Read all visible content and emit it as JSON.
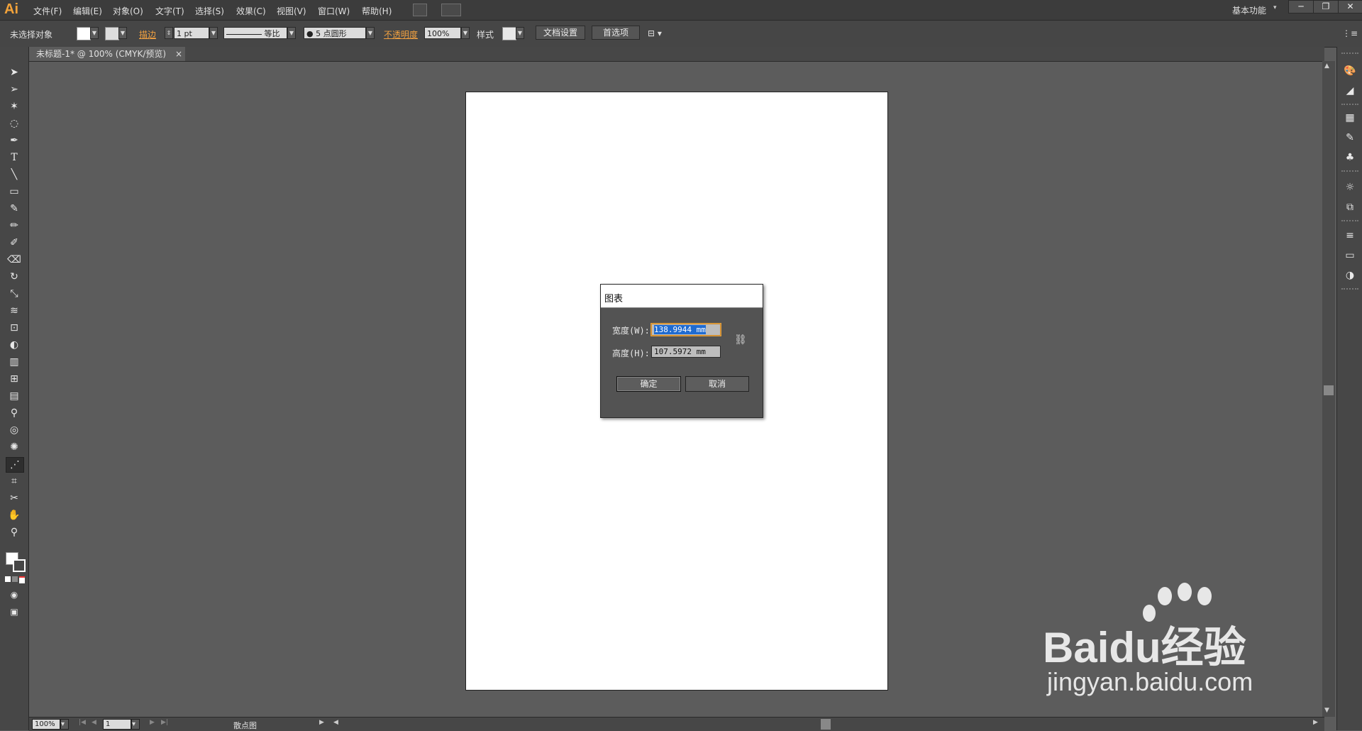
{
  "app": {
    "logo": "Ai"
  },
  "menu": [
    "文件(F)",
    "编辑(E)",
    "对象(O)",
    "文字(T)",
    "选择(S)",
    "效果(C)",
    "视图(V)",
    "窗口(W)",
    "帮助(H)"
  ],
  "workspace": {
    "label": "基本功能"
  },
  "window_controls": {
    "minimize": "─",
    "restore": "❐",
    "close": "✕"
  },
  "controlbar": {
    "selection_status": "未选择对象",
    "stroke_label": "描边",
    "stroke_weight": "1 pt",
    "stroke_profile": "等比",
    "brush": "● 5 点圆形",
    "opacity_label": "不透明度",
    "opacity_value": "100%",
    "style_label": "样式",
    "doc_setup_button": "文档设置",
    "preferences_button": "首选项"
  },
  "document_tab": {
    "title": "未标题-1* @ 100% (CMYK/预览)",
    "close": "×"
  },
  "dialog": {
    "title": "图表",
    "width_label": "宽度(W):",
    "width_value": "138.9944 mm",
    "height_label": "高度(H):",
    "height_value": "107.5972 mm",
    "ok_button": "确定",
    "cancel_button": "取消"
  },
  "statusbar": {
    "zoom": "100%",
    "page": "1",
    "tool_name": "散点图"
  },
  "watermark": {
    "brand": "Baidu经验",
    "url": "jingyan.baidu.com"
  },
  "colors": {
    "accent": "#f2a23a",
    "selection": "#1f6bd1",
    "focus_border": "#d08a2b"
  }
}
